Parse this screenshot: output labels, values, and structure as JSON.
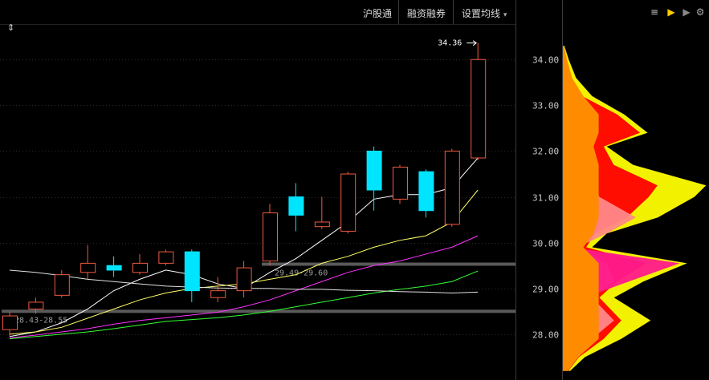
{
  "toolbar": {
    "items": [
      "沪股通",
      "融资融券",
      "设置均线"
    ],
    "dropdown_glyph": "▾",
    "expand_glyph": "⇕"
  },
  "right_tools": [
    {
      "name": "list-icon",
      "glyph": "≡"
    },
    {
      "name": "flag-yellow-icon",
      "glyph": "▶"
    },
    {
      "name": "flag-grey-icon",
      "glyph": "▶"
    },
    {
      "name": "settings-icon",
      "glyph": "⚙"
    }
  ],
  "colors": {
    "up": "#f05a40",
    "down": "#00e5ff",
    "ma5": "#ffffff",
    "ma10": "#ffff66",
    "ma20": "#ff33ff",
    "ma30": "#33ff33",
    "ma60": "#e0e0e0",
    "grid": "#2a2a2a",
    "marker_band": "#5a5a5a"
  },
  "chart_data": {
    "type": "candlestick",
    "ylim": [
      27.0,
      35.3
    ],
    "yticks": [
      "34.00",
      "33.00",
      "32.00",
      "31.00",
      "30.00",
      "29.00",
      "28.00"
    ],
    "ytick_values": [
      34.0,
      33.0,
      32.0,
      31.0,
      30.0,
      29.0,
      28.0
    ],
    "candles": [
      {
        "open": 28.1,
        "close": 28.4,
        "high": 28.48,
        "low": 27.95
      },
      {
        "open": 28.55,
        "close": 28.7,
        "high": 28.8,
        "low": 28.45
      },
      {
        "open": 28.85,
        "close": 29.3,
        "high": 29.4,
        "low": 28.8
      },
      {
        "open": 29.35,
        "close": 29.55,
        "high": 29.95,
        "low": 29.2
      },
      {
        "open": 29.5,
        "close": 29.4,
        "high": 29.7,
        "low": 29.25
      },
      {
        "open": 29.35,
        "close": 29.55,
        "high": 29.75,
        "low": 29.3
      },
      {
        "open": 29.55,
        "close": 29.8,
        "high": 29.85,
        "low": 29.5
      },
      {
        "open": 29.8,
        "close": 28.95,
        "high": 29.85,
        "low": 28.7
      },
      {
        "open": 28.8,
        "close": 28.95,
        "high": 29.25,
        "low": 28.7
      },
      {
        "open": 28.95,
        "close": 29.45,
        "high": 29.6,
        "low": 28.8
      },
      {
        "open": 29.6,
        "close": 30.65,
        "high": 30.85,
        "low": 29.5
      },
      {
        "open": 31.0,
        "close": 30.6,
        "high": 31.3,
        "low": 30.25
      },
      {
        "open": 30.35,
        "close": 30.45,
        "high": 31.0,
        "low": 30.3
      },
      {
        "open": 30.25,
        "close": 31.5,
        "high": 31.55,
        "low": 30.2
      },
      {
        "open": 32.0,
        "close": 31.15,
        "high": 32.1,
        "low": 30.7
      },
      {
        "open": 30.95,
        "close": 31.65,
        "high": 31.7,
        "low": 30.85
      },
      {
        "open": 31.55,
        "close": 30.7,
        "high": 31.6,
        "low": 30.55
      },
      {
        "open": 30.4,
        "close": 32.0,
        "high": 32.05,
        "low": 30.35
      },
      {
        "open": 31.85,
        "close": 34.0,
        "high": 34.36,
        "low": 31.8
      }
    ],
    "moving_averages": [
      {
        "key": "ma5",
        "values": [
          27.95,
          28.05,
          28.25,
          28.55,
          28.95,
          29.2,
          29.4,
          29.3,
          29.1,
          29.0,
          29.35,
          29.65,
          30.05,
          30.45,
          30.95,
          31.05,
          31.05,
          31.2,
          31.85
        ]
      },
      {
        "key": "ma10",
        "values": [
          28.0,
          28.05,
          28.15,
          28.35,
          28.55,
          28.75,
          28.9,
          29.0,
          29.05,
          29.1,
          29.2,
          29.3,
          29.55,
          29.7,
          29.9,
          30.05,
          30.15,
          30.45,
          31.15
        ]
      },
      {
        "key": "ma20",
        "values": [
          27.92,
          27.98,
          28.05,
          28.12,
          28.22,
          28.3,
          28.36,
          28.42,
          28.48,
          28.6,
          28.75,
          28.95,
          29.15,
          29.35,
          29.5,
          29.6,
          29.75,
          29.9,
          30.15
        ]
      },
      {
        "key": "ma30",
        "values": [
          27.9,
          27.95,
          28.0,
          28.05,
          28.12,
          28.2,
          28.28,
          28.32,
          28.36,
          28.42,
          28.5,
          28.6,
          28.7,
          28.8,
          28.9,
          28.98,
          29.05,
          29.15,
          29.38
        ]
      },
      {
        "key": "ma60",
        "values": [
          29.4,
          29.35,
          29.28,
          29.2,
          29.15,
          29.1,
          29.05,
          29.03,
          29.01,
          29.0,
          29.0,
          28.98,
          28.98,
          28.96,
          28.95,
          28.93,
          28.92,
          28.9,
          28.92
        ]
      }
    ],
    "markers": [
      {
        "price": 29.53,
        "label": "29.49-29.60",
        "from_index": 10
      },
      {
        "price": 28.5,
        "label": "28.43-28.55",
        "from_index": 0
      }
    ],
    "high_annotation": {
      "label": "34.36",
      "price": 34.36,
      "index": 18
    },
    "volume_profile": [
      {
        "price": 34.3,
        "a": 0.01,
        "b": 0.0,
        "c": 0.0,
        "d": 0.0
      },
      {
        "price": 34.0,
        "a": 0.04,
        "b": 0.0,
        "c": 0.0,
        "d": 0.0
      },
      {
        "price": 33.6,
        "a": 0.09,
        "b": 0.0,
        "c": 0.0,
        "d": 0.0
      },
      {
        "price": 33.2,
        "a": 0.2,
        "b": 0.03,
        "c": 0.0,
        "d": 0.0
      },
      {
        "price": 32.8,
        "a": 0.42,
        "b": 0.3,
        "c": 0.0,
        "d": 0.0
      },
      {
        "price": 32.4,
        "a": 0.58,
        "b": 0.45,
        "c": 0.0,
        "d": 0.0
      },
      {
        "price": 32.1,
        "a": 0.3,
        "b": 0.25,
        "c": 0.0,
        "d": 0.0
      },
      {
        "price": 31.7,
        "a": 0.48,
        "b": 0.15,
        "c": 0.0,
        "d": 0.0
      },
      {
        "price": 31.25,
        "a": 0.98,
        "b": 0.15,
        "c": 0.22,
        "d": 0.0
      },
      {
        "price": 31.0,
        "a": 0.9,
        "b": 0.12,
        "c": 0.25,
        "d": 0.0
      },
      {
        "price": 30.55,
        "a": 0.65,
        "b": 0.12,
        "c": 0.5,
        "d": 0.0
      },
      {
        "price": 30.2,
        "a": 0.3,
        "b": 0.1,
        "c": 0.3,
        "d": 0.0
      },
      {
        "price": 29.9,
        "a": 0.2,
        "b": 0.1,
        "c": 0.1,
        "d": 0.05
      },
      {
        "price": 29.55,
        "a": 0.85,
        "b": 0.15,
        "c": 0.3,
        "d": 0.8
      },
      {
        "price": 29.15,
        "a": 0.55,
        "b": 0.1,
        "c": 0.35,
        "d": 0.45
      },
      {
        "price": 28.8,
        "a": 0.35,
        "b": 0.1,
        "c": 0.2,
        "d": 0.15
      },
      {
        "price": 28.3,
        "a": 0.6,
        "b": 0.1,
        "c": 0.35,
        "d": 0.1
      },
      {
        "price": 27.9,
        "a": 0.4,
        "b": 0.1,
        "c": 0.2,
        "d": 0.05
      },
      {
        "price": 27.5,
        "a": 0.15,
        "b": 0.05,
        "c": 0.08,
        "d": 0.0
      },
      {
        "price": 27.2,
        "a": 0.05,
        "b": 0.02,
        "c": 0.02,
        "d": 0.0
      }
    ]
  }
}
